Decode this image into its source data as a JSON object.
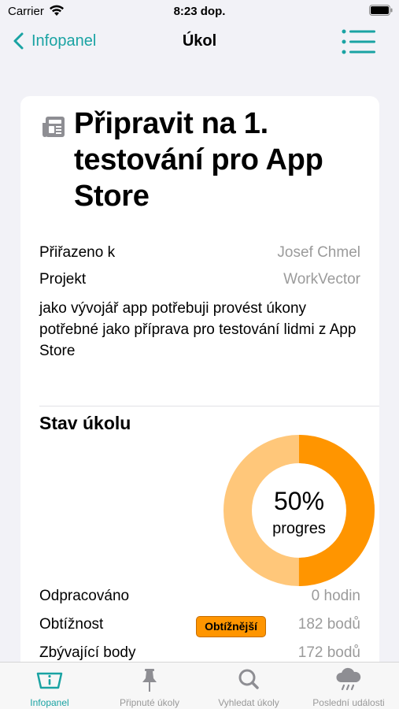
{
  "status_bar": {
    "carrier": "Carrier",
    "time": "8:23 dop."
  },
  "nav": {
    "back_label": "Infopanel",
    "title": "Úkol",
    "accent_color": "#1aa3a3"
  },
  "task": {
    "icon": "newspaper-icon",
    "title": "Připravit na 1. testování pro App Store",
    "assigned_label": "Přiřazeno k",
    "assigned_value": "Josef Chmel",
    "project_label": "Projekt",
    "project_value": "WorkVector",
    "description": "jako vývojář app potřebuji provést úkony potřebné jako příprava pro testování lidmi z App Store"
  },
  "status": {
    "section_title": "Stav úkolu",
    "progress_percent": 50,
    "progress_text": "50%",
    "progress_label": "progres",
    "progress_color": "#ff9500",
    "remaining_color": "#ffc77a",
    "worked_label": "Odpracováno",
    "worked_value": "0 hodin",
    "difficulty_label": "Obtížnost",
    "difficulty_badge": "Obtížnější",
    "difficulty_value": "182 bodů",
    "remaining_label": "Zbývající body",
    "remaining_value": "172 bodů"
  },
  "tabs": [
    {
      "label": "Infopanel",
      "icon": "dashboard-icon",
      "active": true
    },
    {
      "label": "Připnuté úkoly",
      "icon": "pin-icon",
      "active": false
    },
    {
      "label": "Vyhledat úkoly",
      "icon": "search-icon",
      "active": false
    },
    {
      "label": "Poslední události",
      "icon": "cloud-rain-icon",
      "active": false
    }
  ]
}
